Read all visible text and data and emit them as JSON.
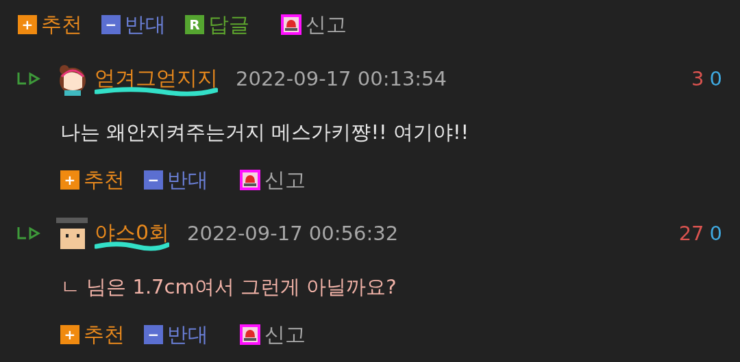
{
  "top_actions": [
    {
      "kind": "recommend",
      "badge": "+",
      "label": "추천"
    },
    {
      "kind": "oppose",
      "badge": "−",
      "label": "반대"
    },
    {
      "kind": "reply",
      "badge": "R",
      "label": "답글"
    },
    {
      "kind": "report",
      "label": "신고"
    }
  ],
  "comments": [
    {
      "avatar": {
        "kind": "girl"
      },
      "username": "얻겨그얻지지",
      "time": "2022-09-17 00:13:54",
      "up": "3",
      "down": "0",
      "body": "나는 왜안지켜주는거지 메스가키쨩!! 여기야!!",
      "highlighted": false,
      "actions": [
        {
          "kind": "recommend",
          "badge": "+",
          "label": "추천"
        },
        {
          "kind": "oppose",
          "badge": "−",
          "label": "반대"
        },
        {
          "kind": "report",
          "label": "신고"
        }
      ]
    },
    {
      "avatar": {
        "kind": "boy"
      },
      "username": "야스0회",
      "time": "2022-09-17 00:56:32",
      "up": "27",
      "down": "0",
      "body": "ㄴ 님은 1.7cm여서 그런게 아닐까요?",
      "highlighted": true,
      "actions": [
        {
          "kind": "recommend",
          "badge": "+",
          "label": "추천"
        },
        {
          "kind": "oppose",
          "badge": "−",
          "label": "반대"
        },
        {
          "kind": "report",
          "label": "신고"
        }
      ]
    }
  ]
}
